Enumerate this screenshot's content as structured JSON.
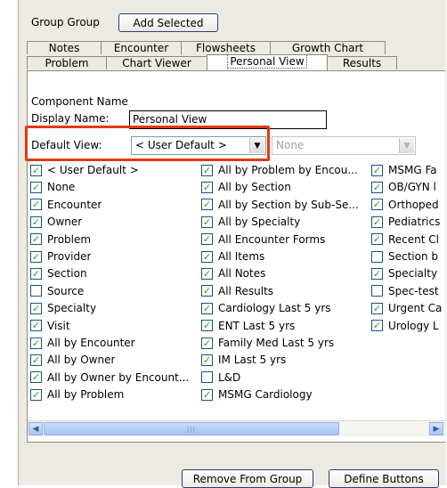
{
  "toolbar": {
    "group_label": "Group Group",
    "add_selected_label": "Add Selected"
  },
  "tabs_row1": [
    "Notes",
    "Encounter",
    "Flowsheets",
    "Growth Chart"
  ],
  "tabs_row2": [
    "Problem",
    "Chart Viewer",
    "Personal View",
    "Results"
  ],
  "active_tab": "Personal View",
  "form": {
    "component_name_label": "Component Name",
    "display_name_label": "Display Name:",
    "display_name_value": "Personal View",
    "default_view_label": "Default View:",
    "default_view_value": "< User Default >",
    "second_select_value": "None"
  },
  "checkbox_col1": [
    {
      "label": "< User Default >",
      "checked": true
    },
    {
      "label": "None",
      "checked": true
    },
    {
      "label": "Encounter",
      "checked": true
    },
    {
      "label": "Owner",
      "checked": true
    },
    {
      "label": "Problem",
      "checked": true
    },
    {
      "label": "Provider",
      "checked": true
    },
    {
      "label": "Section",
      "checked": true
    },
    {
      "label": "Source",
      "checked": false
    },
    {
      "label": "Specialty",
      "checked": true
    },
    {
      "label": "Visit",
      "checked": true
    },
    {
      "label": "All by Encounter",
      "checked": true
    },
    {
      "label": "All by Owner",
      "checked": true
    },
    {
      "label": "All by Owner by Encount...",
      "checked": true
    },
    {
      "label": "All by Problem",
      "checked": true
    }
  ],
  "checkbox_col2": [
    {
      "label": "All by Problem by Encou...",
      "checked": true
    },
    {
      "label": "All by Section",
      "checked": true
    },
    {
      "label": "All by Section by Sub-Se...",
      "checked": true
    },
    {
      "label": "All by Specialty",
      "checked": true
    },
    {
      "label": "All Encounter Forms",
      "checked": true
    },
    {
      "label": "All Items",
      "checked": true
    },
    {
      "label": "All Notes",
      "checked": true
    },
    {
      "label": "All Results",
      "checked": true
    },
    {
      "label": "Cardiology Last 5 yrs",
      "checked": true
    },
    {
      "label": "ENT Last 5 yrs",
      "checked": true
    },
    {
      "label": "Family Med Last 5 yrs",
      "checked": true
    },
    {
      "label": "IM Last 5 yrs",
      "checked": true
    },
    {
      "label": "L&D",
      "checked": false
    },
    {
      "label": "MSMG Cardiology",
      "checked": true
    }
  ],
  "checkbox_col3": [
    {
      "label": "MSMG Fa",
      "checked": true
    },
    {
      "label": "OB/GYN l",
      "checked": true
    },
    {
      "label": "Orthoped",
      "checked": true
    },
    {
      "label": "Pediatrics",
      "checked": true
    },
    {
      "label": "Recent Cl",
      "checked": true
    },
    {
      "label": "Section b",
      "checked": false
    },
    {
      "label": "Specialty",
      "checked": true
    },
    {
      "label": "Spec-test",
      "checked": false
    },
    {
      "label": "Urgent Ca",
      "checked": true
    },
    {
      "label": "Urology L",
      "checked": true
    }
  ],
  "footer": {
    "remove_label": "Remove From Group",
    "define_label": "Define Buttons"
  },
  "colors": {
    "highlight": "#e03a17",
    "check": "#21a121"
  }
}
